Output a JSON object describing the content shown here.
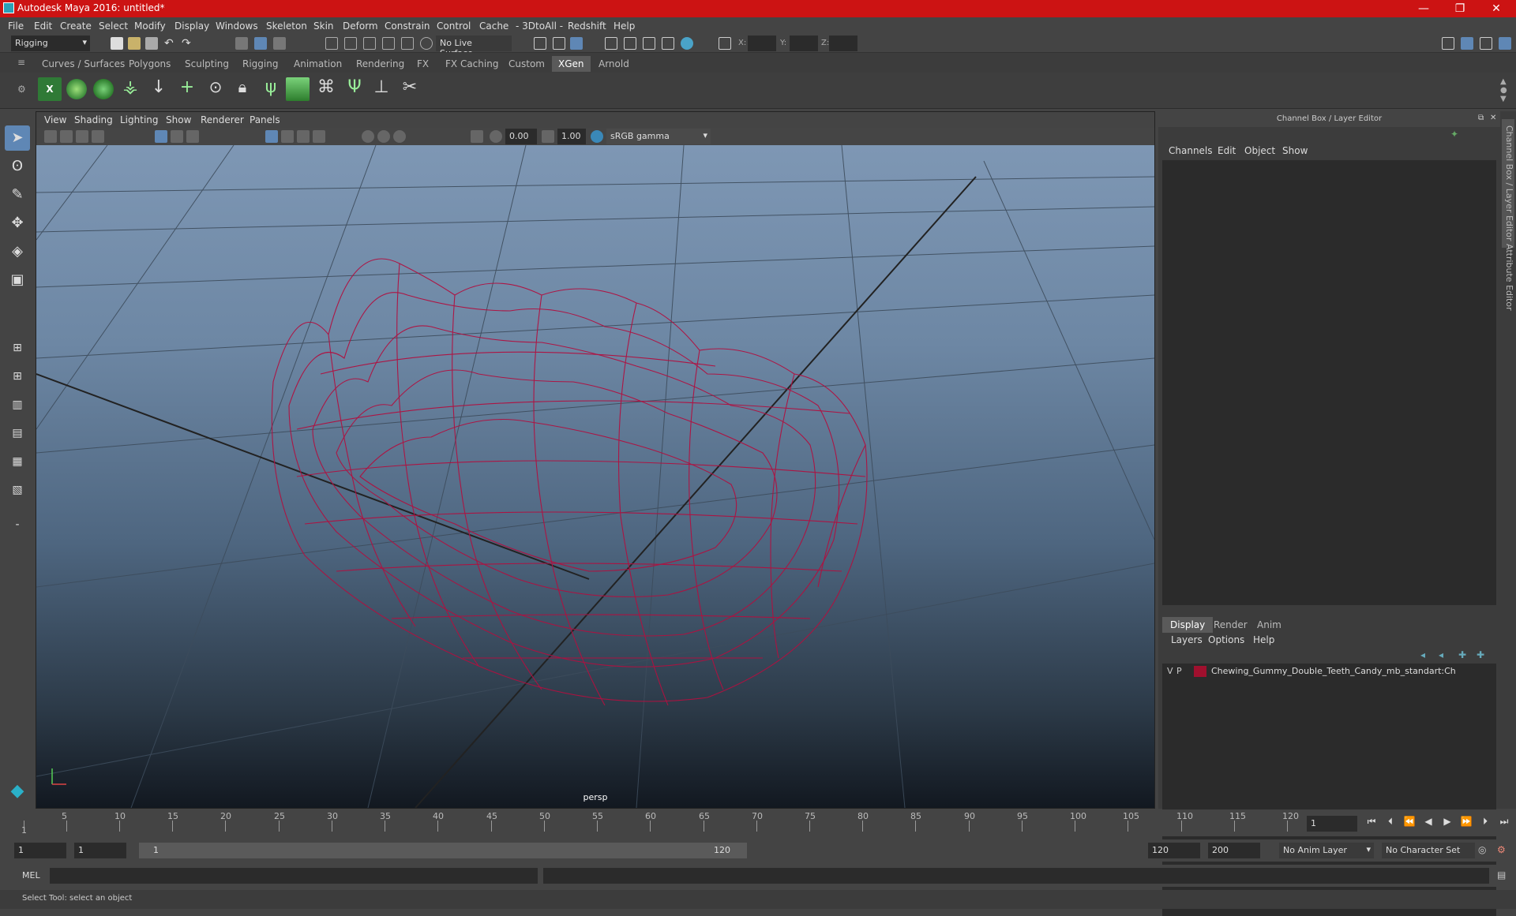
{
  "window": {
    "title": "Autodesk Maya 2016: untitled*",
    "controls": [
      "—",
      "❐",
      "✕"
    ]
  },
  "menubar": [
    "File",
    "Edit",
    "Create",
    "Select",
    "Modify",
    "Display",
    "Windows",
    "Skeleton",
    "Skin",
    "Deform",
    "Constrain",
    "Control",
    "Cache",
    "- 3DtoAll -",
    "Redshift",
    "Help"
  ],
  "statusline": {
    "menuset": "Rigging",
    "live_surface": "No Live Surface",
    "x_label": "X:",
    "y_label": "Y:",
    "z_label": "Z:"
  },
  "shelf_tabs": [
    "Curves / Surfaces",
    "Polygons",
    "Sculpting",
    "Rigging",
    "Animation",
    "Rendering",
    "FX",
    "FX Caching",
    "Custom",
    "XGen",
    "Arnold"
  ],
  "active_shelf": "XGen",
  "viewport": {
    "menu": [
      "View",
      "Shading",
      "Lighting",
      "Show",
      "Renderer",
      "Panels"
    ],
    "exposure": "0.00",
    "gamma": "1.00",
    "color_space": "sRGB gamma",
    "camera": "persp",
    "wireframe_color": "#b01040"
  },
  "channel_box": {
    "title": "Channel Box / Layer Editor",
    "menu": [
      "Channels",
      "Edit",
      "Object",
      "Show"
    ]
  },
  "layer_editor": {
    "tabs": [
      "Display",
      "Render",
      "Anim"
    ],
    "active_tab": "Display",
    "menu": [
      "Layers",
      "Options",
      "Help"
    ],
    "layers": [
      {
        "v": "V",
        "p": "P",
        "color": "#a0102e",
        "name": "Chewing_Gummy_Double_Teeth_Candy_mb_standart:Ch"
      }
    ]
  },
  "side_tabs": [
    "Channel Box / Layer Editor",
    "Attribute Editor"
  ],
  "timeline": {
    "ticks": [
      "1",
      "5",
      "10",
      "15",
      "20",
      "25",
      "30",
      "35",
      "40",
      "45",
      "50",
      "55",
      "60",
      "65",
      "70",
      "75",
      "80",
      "85",
      "90",
      "95",
      "100",
      "105",
      "110",
      "115",
      "120"
    ],
    "current_frame": "1"
  },
  "range": {
    "start": "1",
    "start2": "1",
    "inner_start": "1",
    "inner_end": "120",
    "end": "120",
    "end2": "200",
    "anim_layer": "No Anim Layer",
    "char_set": "No Character Set"
  },
  "cmdline": {
    "label": "MEL"
  },
  "helpline": "Select Tool: select an object"
}
